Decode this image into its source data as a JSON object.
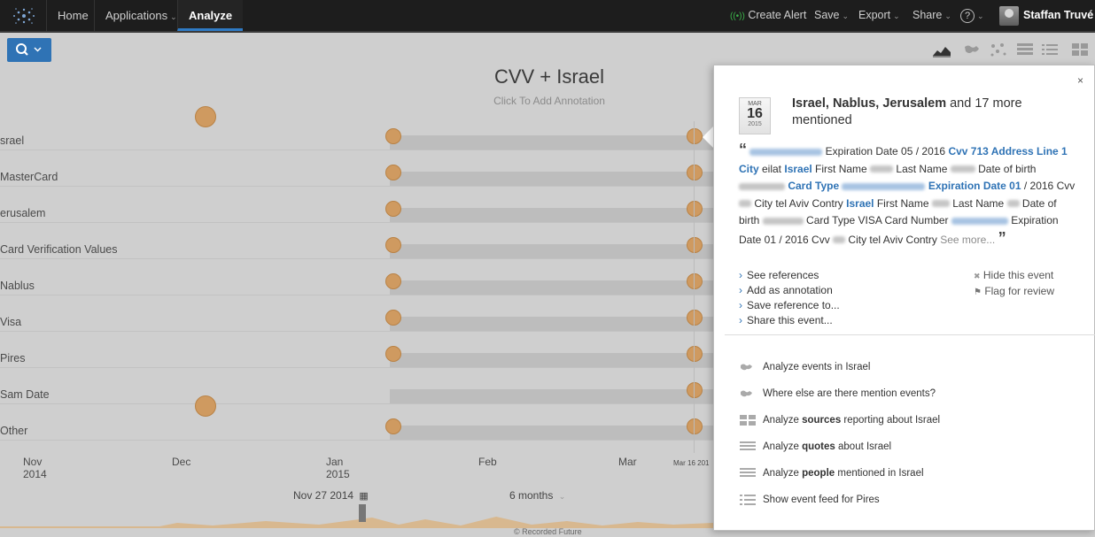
{
  "nav": {
    "home": "Home",
    "applications": "Applications",
    "analyze": "Analyze",
    "create_alert": "Create Alert",
    "save": "Save",
    "export": "Export",
    "share": "Share",
    "help": "?",
    "user": "Staffan Truvé"
  },
  "chart": {
    "title": "CVV + Israel",
    "subtitle": "Click To Add Annotation",
    "rows": [
      "srael",
      "MasterCard",
      "erusalem",
      "Card Verification Values",
      "Nablus",
      "Visa",
      "Pires",
      "Sam Date",
      "Other"
    ],
    "xaxis": [
      {
        "label": "Nov",
        "sub": "2014"
      },
      {
        "label": "Dec",
        "sub": ""
      },
      {
        "label": "Jan",
        "sub": "2015"
      },
      {
        "label": "Feb",
        "sub": ""
      },
      {
        "label": "Mar",
        "sub": ""
      }
    ],
    "marker_date": "Mar 16 201",
    "range_start": "Nov 27 2014",
    "range_span": "6 months",
    "footer": "© Recorded Future"
  },
  "panel": {
    "close": "×",
    "date": {
      "month": "MAR",
      "day": "16",
      "year": "2015"
    },
    "headline_bold": "Israel, Nablus, Jerusalem",
    "headline_rest": " and 17 more mentioned",
    "quote": {
      "t1": " Expiration Date 05 / 2016 ",
      "k1": "Cvv 713 Address Line 1 City",
      "t2": " eilat ",
      "k2": "Israel",
      "t3": " First Name ",
      "t4": " Last Name ",
      "t5": " Date of birth ",
      "k3": "Card Type",
      "k4": "Expiration Date 01",
      "t6": " / 2016 Cvv ",
      "t7": " City tel Aviv Contry ",
      "k5": "Israel",
      "t8": " First Name ",
      "t9": " Last Name ",
      "t10": " Date of birth ",
      "t11": " Card Type VISA Card Number ",
      "t12": " Expiration Date 01 / 2016 Cvv ",
      "t13": " City tel Aviv Contry ",
      "see_more": "See more..."
    },
    "actions": [
      "See references",
      "Add as annotation",
      "Save reference to...",
      "Share this event..."
    ],
    "hide_event": "Hide this event",
    "flag_review": "Flag for review",
    "analyze": [
      {
        "pre": "Analyze events in Israel",
        "bold": "",
        "post": ""
      },
      {
        "pre": "Where else are there mention events?",
        "bold": "",
        "post": ""
      },
      {
        "pre": "Analyze ",
        "bold": "sources",
        "post": " reporting about Israel"
      },
      {
        "pre": "Analyze ",
        "bold": "quotes",
        "post": " about Israel"
      },
      {
        "pre": "Analyze ",
        "bold": "people",
        "post": " mentioned in Israel"
      },
      {
        "pre": "Show event feed for Pires",
        "bold": "",
        "post": ""
      }
    ]
  },
  "colors": {
    "accent": "#2f73b5",
    "dot": "#cf9a60",
    "topbar": "#1d1d1d"
  }
}
